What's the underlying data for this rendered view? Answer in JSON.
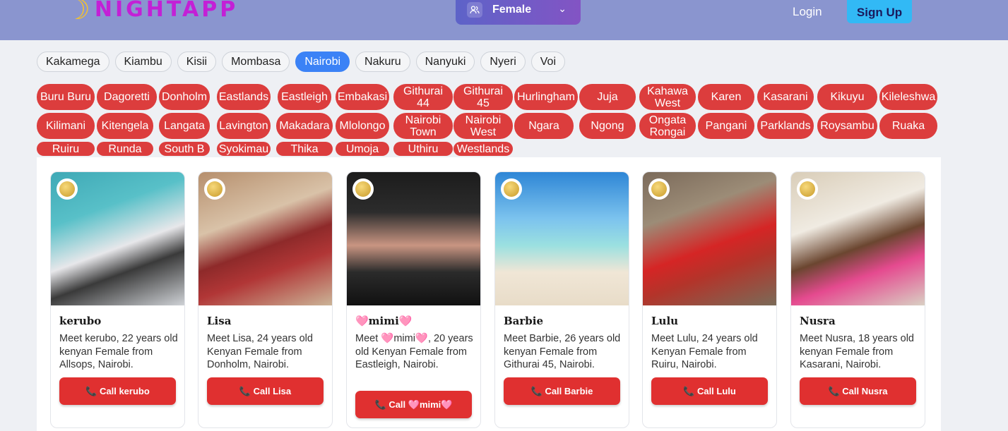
{
  "header": {
    "logo_text": "NIGHTAPP",
    "logo_icon": "moon-icon",
    "gender_select": {
      "value": "Female",
      "icon": "user-icon"
    },
    "login_label": "Login",
    "signup_label": "Sign Up"
  },
  "cities": [
    "Kakamega",
    "Kiambu",
    "Kisii",
    "Mombasa",
    "Nairobi",
    "Nakuru",
    "Nanyuki",
    "Nyeri",
    "Voi"
  ],
  "active_city": "Nairobi",
  "areas": [
    "Buru Buru",
    "Dagoretti",
    "Donholm",
    "Eastlands",
    "Eastleigh",
    "Embakasi",
    "Githurai 44",
    "Githurai 45",
    "Hurlingham",
    "Juja",
    "Kahawa West",
    "Karen",
    "Kasarani",
    "Kikuyu",
    "Kileleshwa",
    "Kilimani",
    "Kitengela",
    "Langata",
    "Lavington",
    "Makadara",
    "Mlolongo",
    "Nairobi Town",
    "Nairobi West",
    "Ngara",
    "Ngong",
    "Ongata Rongai",
    "Pangani",
    "Parklands",
    "Roysambu",
    "Ruaka",
    "Ruiru",
    "Runda",
    "South B",
    "Syokimau",
    "Thika",
    "Umoja",
    "Uthiru",
    "Westlands"
  ],
  "profiles": [
    {
      "name": "kerubo",
      "desc": "Meet kerubo, 22 years old kenyan Female from Allsops, Nairobi.",
      "call": "📞 Call kerubo"
    },
    {
      "name": "Lisa",
      "desc": "Meet Lisa, 24 years old Kenyan Female from Donholm, Nairobi.",
      "call": "📞 Call Lisa"
    },
    {
      "name": "🩷mimi🩷",
      "desc": "Meet 🩷mimi🩷, 20 years old Kenyan Female from Eastleigh, Nairobi.",
      "call": "📞 Call 🩷mimi🩷"
    },
    {
      "name": "Barbie",
      "desc": "Meet Barbie, 26 years old kenyan Female from Githurai 45, Nairobi.",
      "call": "📞 Call Barbie"
    },
    {
      "name": "Lulu",
      "desc": "Meet Lulu, 24 years old Kenyan Female from Ruiru, Nairobi.",
      "call": "📞 Call Lulu"
    },
    {
      "name": "Nusra",
      "desc": "Meet Nusra, 18 years old kenyan Female from Kasarani, Nairobi.",
      "call": "📞 Call Nusra"
    }
  ],
  "colors": {
    "header": "#8a95cf",
    "accent": "#3b82f6",
    "area_pill": "#dc3d3d",
    "call_button": "#e03030",
    "signup": "#32b9f5"
  }
}
